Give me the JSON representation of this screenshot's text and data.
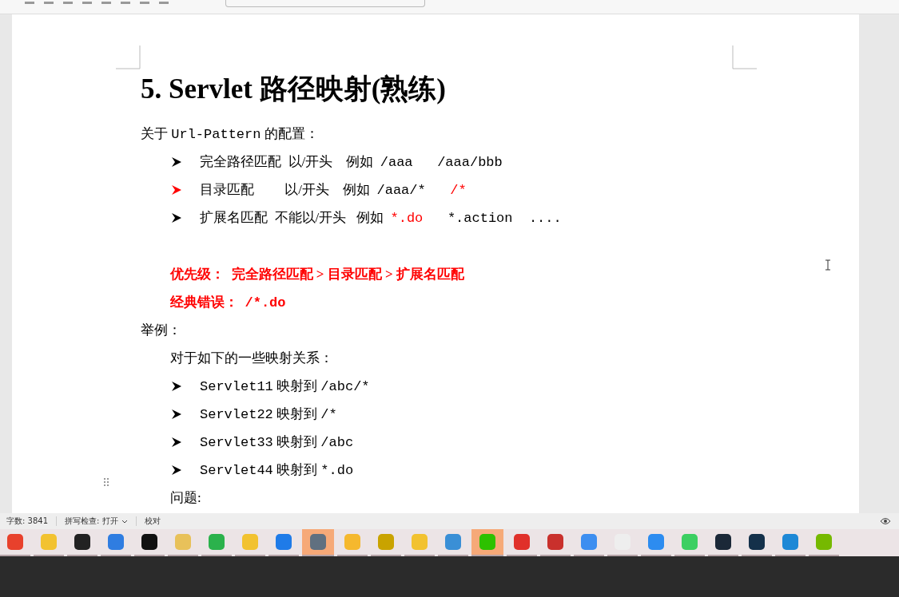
{
  "document": {
    "title": "5. Servlet 路径映射(熟练)",
    "blocks": [
      {
        "kind": "para",
        "segments": [
          {
            "text": "关于 ",
            "kind": "text",
            "red": false
          },
          {
            "text": "Url-Pattern",
            "kind": "code",
            "red": false
          },
          {
            "text": " 的配置：",
            "kind": "text",
            "red": false
          }
        ]
      },
      {
        "kind": "bullet",
        "red_marker": false,
        "segments": [
          {
            "text": "完全路径匹配  以/开头    例如  ",
            "kind": "text",
            "red": false
          },
          {
            "text": "/aaa   /aaa/bbb",
            "kind": "code",
            "red": false
          }
        ]
      },
      {
        "kind": "bullet",
        "red_marker": true,
        "segments": [
          {
            "text": "目录匹配         以/开头    例如  ",
            "kind": "text",
            "red": false
          },
          {
            "text": "/aaa/*   ",
            "kind": "code",
            "red": false
          },
          {
            "text": "/*",
            "kind": "code",
            "red": true
          }
        ]
      },
      {
        "kind": "bullet",
        "red_marker": false,
        "segments": [
          {
            "text": "扩展名匹配  不能以/开头   例如  ",
            "kind": "text",
            "red": false
          },
          {
            "text": "*.do",
            "kind": "code",
            "red": true
          },
          {
            "text": "   *.action  ....",
            "kind": "code",
            "red": false
          }
        ]
      },
      {
        "kind": "spacer"
      },
      {
        "kind": "note",
        "segments": [
          {
            "text": "优先级：  完全路径匹配 > 目录匹配 > 扩展名匹配",
            "kind": "text",
            "red": true
          }
        ]
      },
      {
        "kind": "note",
        "segments": [
          {
            "text": "经典错误：  ",
            "kind": "text",
            "red": true
          },
          {
            "text": "/*.do",
            "kind": "code",
            "red": true
          }
        ]
      },
      {
        "kind": "para",
        "segments": [
          {
            "text": "举例：",
            "kind": "text",
            "red": false
          }
        ]
      },
      {
        "kind": "subpara",
        "segments": [
          {
            "text": "对于如下的一些映射关系：",
            "kind": "text",
            "red": false
          }
        ]
      },
      {
        "kind": "bullet",
        "red_marker": false,
        "segments": [
          {
            "text": "Servlet11",
            "kind": "code",
            "red": false
          },
          {
            "text": " 映射到 ",
            "kind": "text",
            "red": false
          },
          {
            "text": "/abc/*",
            "kind": "code",
            "red": false
          }
        ]
      },
      {
        "kind": "bullet",
        "red_marker": false,
        "segments": [
          {
            "text": "Servlet22",
            "kind": "code",
            "red": false
          },
          {
            "text": " 映射到 ",
            "kind": "text",
            "red": false
          },
          {
            "text": "/*",
            "kind": "code",
            "red": false
          }
        ]
      },
      {
        "kind": "bullet",
        "red_marker": false,
        "segments": [
          {
            "text": "Servlet33",
            "kind": "code",
            "red": false
          },
          {
            "text": " 映射到 ",
            "kind": "text",
            "red": false
          },
          {
            "text": "/abc",
            "kind": "code",
            "red": false
          }
        ]
      },
      {
        "kind": "bullet",
        "red_marker": false,
        "segments": [
          {
            "text": "Servlet44",
            "kind": "code",
            "red": false
          },
          {
            "text": " 映射到 ",
            "kind": "text",
            "red": false
          },
          {
            "text": "*.do",
            "kind": "code",
            "red": false
          }
        ]
      },
      {
        "kind": "subpara",
        "segments": [
          {
            "text": "问题:",
            "kind": "text",
            "red": false
          }
        ]
      }
    ]
  },
  "status_bar": {
    "word_count": "字数: 3841",
    "spell_check": "拼写检查: 打开",
    "proofread": "校对"
  },
  "taskbar": {
    "apps": [
      {
        "color": "#e8412c",
        "active": false
      },
      {
        "color": "#f2c230",
        "active": false
      },
      {
        "color": "#222222",
        "active": false
      },
      {
        "color": "#2f7de1",
        "active": false
      },
      {
        "color": "#111111",
        "active": false
      },
      {
        "color": "#e8c15a",
        "active": false
      },
      {
        "color": "#2bb24c",
        "active": false
      },
      {
        "color": "#f2c230",
        "active": false
      },
      {
        "color": "#1f7be8",
        "active": false
      },
      {
        "color": "#607080",
        "active": true
      },
      {
        "color": "#f5b82e",
        "active": false
      },
      {
        "color": "#c9a300",
        "active": false
      },
      {
        "color": "#f2c230",
        "active": false
      },
      {
        "color": "#3a8fd6",
        "active": false
      },
      {
        "color": "#2dc100",
        "active": true
      },
      {
        "color": "#e0302a",
        "active": false
      },
      {
        "color": "#c9302c",
        "active": false
      },
      {
        "color": "#3d8ef0",
        "active": false
      },
      {
        "color": "#eeeeee",
        "active": false
      },
      {
        "color": "#2d8cf0",
        "active": false
      },
      {
        "color": "#3ccf62",
        "active": false
      },
      {
        "color": "#1b2838",
        "active": false
      },
      {
        "color": "#14304a",
        "active": false
      },
      {
        "color": "#1e88d6",
        "active": false
      },
      {
        "color": "#76b900",
        "active": false
      }
    ]
  }
}
